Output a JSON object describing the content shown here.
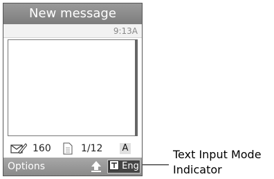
{
  "header": {
    "title": "New message"
  },
  "status": {
    "time": "9:13A"
  },
  "counter": {
    "chars_left": "160",
    "pages": "1/12",
    "case_label": "A"
  },
  "softkeys": {
    "left_label": "Options",
    "input_mode_label": "Eng"
  },
  "callout": {
    "line1": "Text Input Mode",
    "line2": "Indicator"
  },
  "icons": {
    "chars": "pen-envelope-icon",
    "pages": "page-icon",
    "upload": "upload-arrow-icon",
    "mode": "t9-icon"
  }
}
